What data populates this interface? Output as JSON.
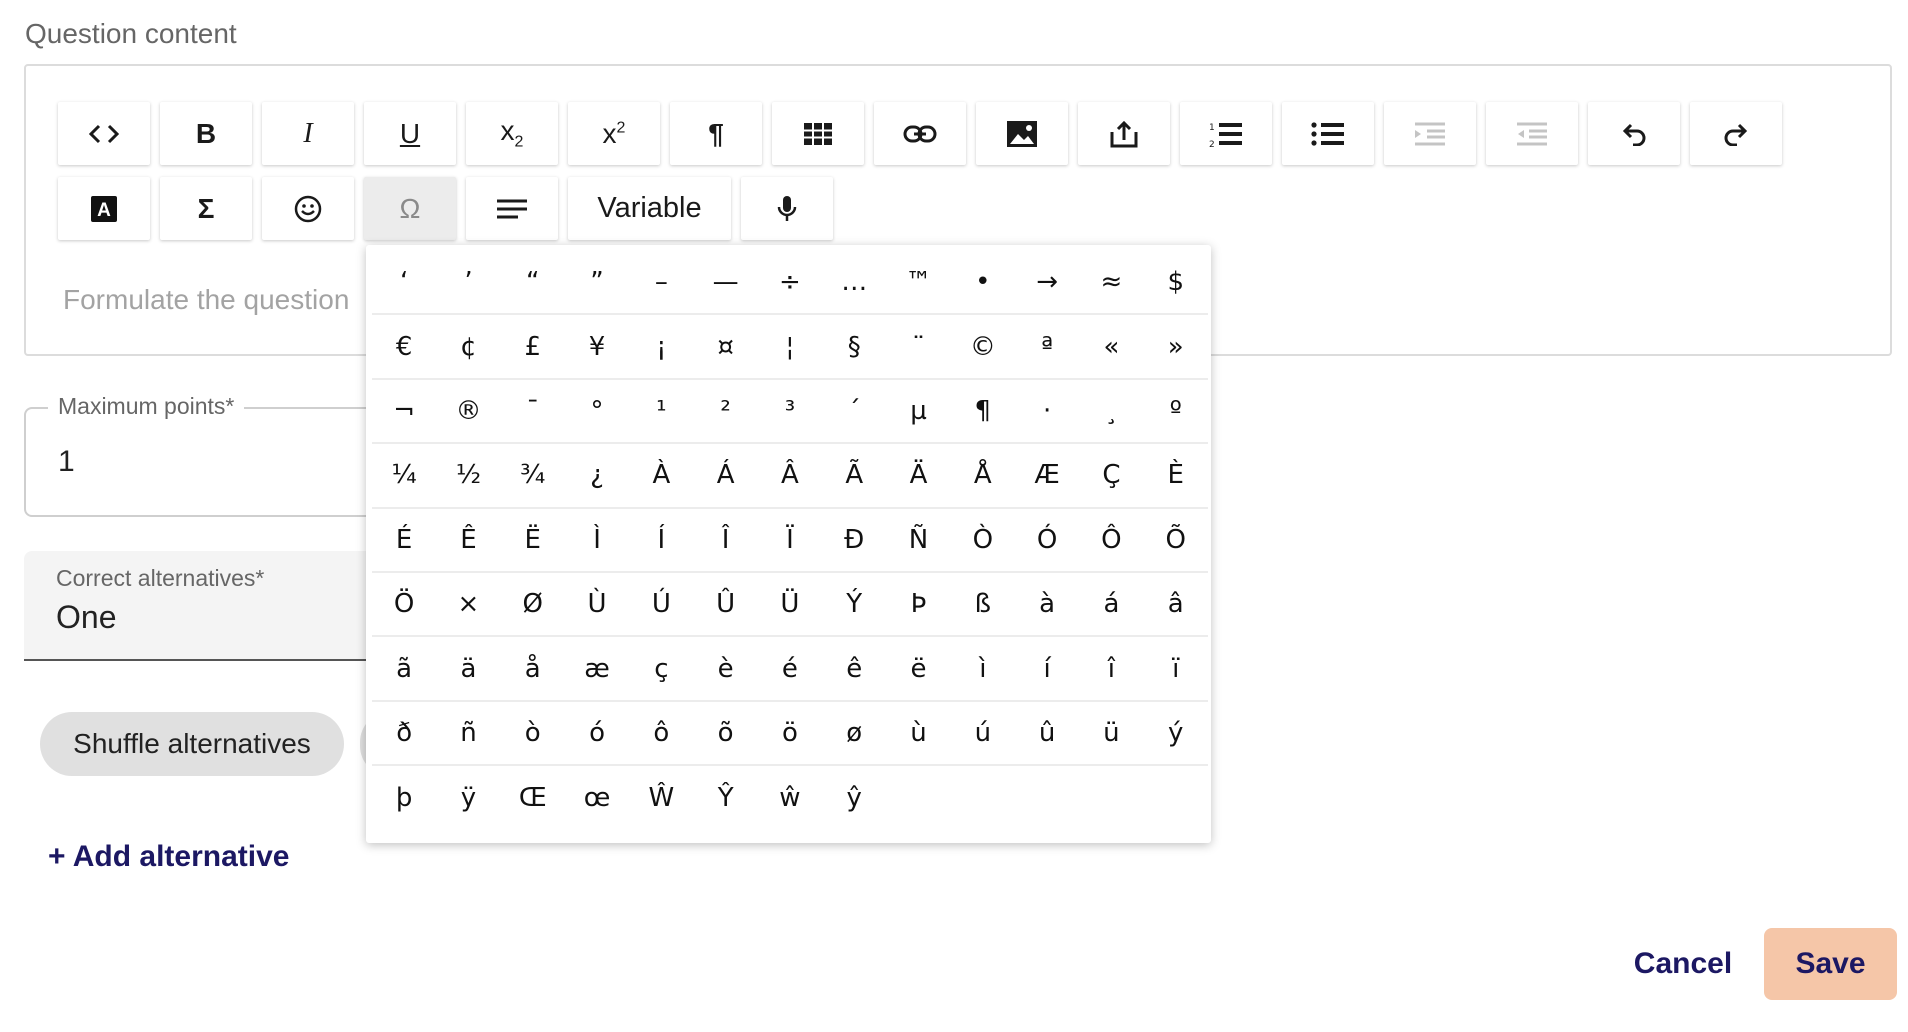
{
  "section_label": "Question content",
  "toolbar": {
    "row1": [
      {
        "name": "source-code-button",
        "icon": "code-icon",
        "glyph": "<>",
        "disabled": false
      },
      {
        "name": "bold-button",
        "icon": "bold-icon",
        "glyph": "B",
        "disabled": false
      },
      {
        "name": "italic-button",
        "icon": "italic-icon",
        "glyph": "I",
        "disabled": false
      },
      {
        "name": "underline-button",
        "icon": "underline-icon",
        "glyph": "U",
        "disabled": false
      },
      {
        "name": "subscript-button",
        "icon": "subscript-icon",
        "glyph": "x₂",
        "disabled": false
      },
      {
        "name": "superscript-button",
        "icon": "superscript-icon",
        "glyph": "x²",
        "disabled": false
      },
      {
        "name": "paragraph-button",
        "icon": "pilcrow-icon",
        "glyph": "¶",
        "disabled": false
      },
      {
        "name": "table-button",
        "icon": "table-icon",
        "glyph": "",
        "disabled": false
      },
      {
        "name": "link-button",
        "icon": "link-icon",
        "glyph": "",
        "disabled": false
      },
      {
        "name": "image-button",
        "icon": "image-icon",
        "glyph": "",
        "disabled": false
      },
      {
        "name": "upload-button",
        "icon": "upload-icon",
        "glyph": "",
        "disabled": false
      },
      {
        "name": "numbered-list-button",
        "icon": "numbered-list-icon",
        "glyph": "",
        "disabled": false
      },
      {
        "name": "bullet-list-button",
        "icon": "bullet-list-icon",
        "glyph": "",
        "disabled": false
      },
      {
        "name": "indent-button",
        "icon": "indent-icon",
        "glyph": "",
        "disabled": true
      },
      {
        "name": "outdent-button",
        "icon": "outdent-icon",
        "glyph": "",
        "disabled": true
      },
      {
        "name": "undo-button",
        "icon": "undo-icon",
        "glyph": "↶",
        "disabled": false
      },
      {
        "name": "redo-button",
        "icon": "redo-icon",
        "glyph": "↷",
        "disabled": false
      }
    ],
    "row2": [
      {
        "name": "text-color-button",
        "icon": "text-color-icon",
        "glyph": "A"
      },
      {
        "name": "formula-button",
        "icon": "sigma-icon",
        "glyph": "Σ"
      },
      {
        "name": "emoji-button",
        "icon": "smiley-icon",
        "glyph": "☺"
      },
      {
        "name": "special-characters-button",
        "icon": "omega-icon",
        "glyph": "Ω",
        "active": true
      },
      {
        "name": "align-button",
        "icon": "align-left-icon",
        "glyph": ""
      },
      {
        "name": "variable-button",
        "icon": "",
        "glyph": "Variable",
        "wide": true
      },
      {
        "name": "microphone-button",
        "icon": "microphone-icon",
        "glyph": ""
      }
    ]
  },
  "editor": {
    "placeholder": "Formulate the question"
  },
  "max_points": {
    "label": "Maximum points*",
    "value": "1"
  },
  "correct_alternatives": {
    "label": "Correct alternatives*",
    "value": "One"
  },
  "shuffle_chip": "Shuffle alternatives",
  "add_alternative": "+ Add alternative",
  "cancel_label": "Cancel",
  "save_label": "Save",
  "colors": {
    "accent": "#1c1863",
    "save_bg": "#f5c6a8",
    "chip_bg": "#e0e0e0"
  },
  "special_characters": [
    "‘",
    "’",
    "“",
    "”",
    "–",
    "—",
    "÷",
    "…",
    "™",
    "•",
    "→",
    "≈",
    "$",
    "€",
    "¢",
    "£",
    "¥",
    "¡",
    "¤",
    "¦",
    "§",
    "¨",
    "©",
    "ª",
    "«",
    "»",
    "¬",
    "®",
    "¯",
    "°",
    "¹",
    "²",
    "³",
    "´",
    "µ",
    "¶",
    "·",
    "¸",
    "º",
    "¼",
    "½",
    "¾",
    "¿",
    "À",
    "Á",
    "Â",
    "Ã",
    "Ä",
    "Å",
    "Æ",
    "Ç",
    "È",
    "É",
    "Ê",
    "Ë",
    "Ì",
    "Í",
    "Î",
    "Ï",
    "Ð",
    "Ñ",
    "Ò",
    "Ó",
    "Ô",
    "Õ",
    "Ö",
    "×",
    "Ø",
    "Ù",
    "Ú",
    "Û",
    "Ü",
    "Ý",
    "Þ",
    "ß",
    "à",
    "á",
    "â",
    "ã",
    "ä",
    "å",
    "æ",
    "ç",
    "è",
    "é",
    "ê",
    "ë",
    "ì",
    "í",
    "î",
    "ï",
    "ð",
    "ñ",
    "ò",
    "ó",
    "ô",
    "õ",
    "ö",
    "ø",
    "ù",
    "ú",
    "û",
    "ü",
    "ý",
    "þ",
    "ÿ",
    "Œ",
    "œ",
    "Ŵ",
    "Ŷ",
    "ŵ",
    "ŷ"
  ]
}
